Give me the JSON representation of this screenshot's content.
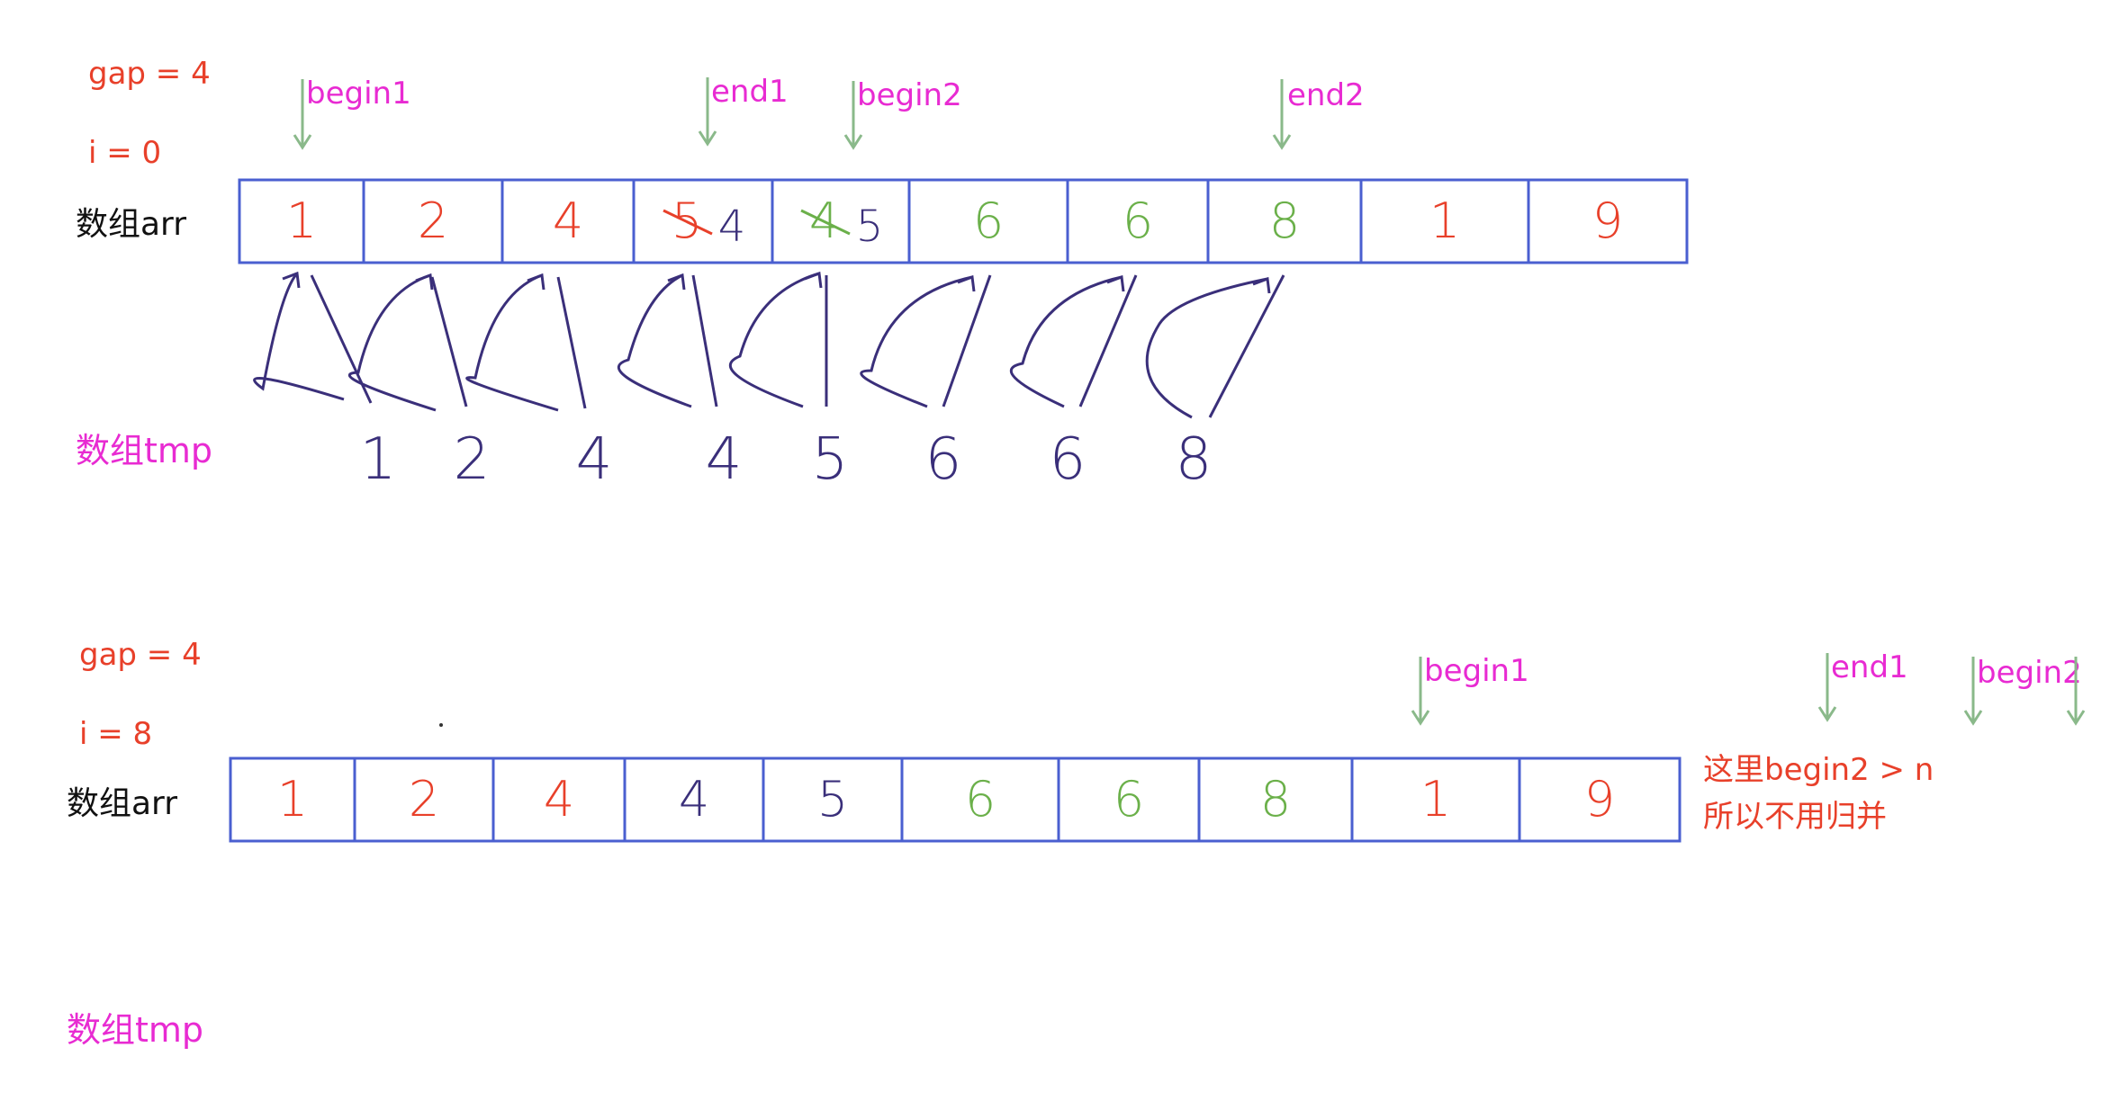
{
  "panel1": {
    "gap_label": "gap = 4",
    "i_label": "i = 0",
    "arr_label": "数组arr",
    "tmp_label": "数组tmp",
    "pointers": [
      "begin1",
      "end1",
      "begin2",
      "end2"
    ],
    "arr_cells": [
      {
        "value": "1",
        "color": "#e8402a"
      },
      {
        "value": "2",
        "color": "#e8402a"
      },
      {
        "value": "4",
        "color": "#e8402a"
      },
      {
        "value": "5",
        "color": "#e8402a",
        "struck": true,
        "replacement": "4",
        "replacement_color": "#3a2f7a"
      },
      {
        "value": "4",
        "color": "#6bb04a",
        "struck": true,
        "replacement": "5",
        "replacement_color": "#3a2f7a"
      },
      {
        "value": "6",
        "color": "#6bb04a"
      },
      {
        "value": "6",
        "color": "#6bb04a"
      },
      {
        "value": "8",
        "color": "#6bb04a"
      },
      {
        "value": "1",
        "color": "#e8402a"
      },
      {
        "value": "9",
        "color": "#e8402a"
      }
    ],
    "tmp_values": [
      "1",
      "2",
      "4",
      "4",
      "5",
      "6",
      "6",
      "8"
    ]
  },
  "panel2": {
    "gap_label": "gap = 4",
    "i_label": "i = 8",
    "arr_label": "数组arr",
    "tmp_label": "数组tmp",
    "pointers": [
      "begin1",
      "end1",
      "begin2"
    ],
    "arr_cells": [
      {
        "value": "1",
        "color": "#e8402a"
      },
      {
        "value": "2",
        "color": "#e8402a"
      },
      {
        "value": "4",
        "color": "#e8402a"
      },
      {
        "value": "4",
        "color": "#3a2f7a"
      },
      {
        "value": "5",
        "color": "#3a2f7a"
      },
      {
        "value": "6",
        "color": "#6bb04a"
      },
      {
        "value": "6",
        "color": "#6bb04a"
      },
      {
        "value": "8",
        "color": "#6bb04a"
      },
      {
        "value": "1",
        "color": "#e8402a"
      },
      {
        "value": "9",
        "color": "#e8402a"
      }
    ],
    "note_line1": "这里begin2 > n",
    "note_line2": "所以不用归并"
  },
  "colors": {
    "cell_border": "#4a5fd0",
    "arrow_green": "#8ab98a",
    "curve_purple": "#3a2f7a",
    "label_magenta": "#e82bd2",
    "label_red": "#e8402a"
  }
}
